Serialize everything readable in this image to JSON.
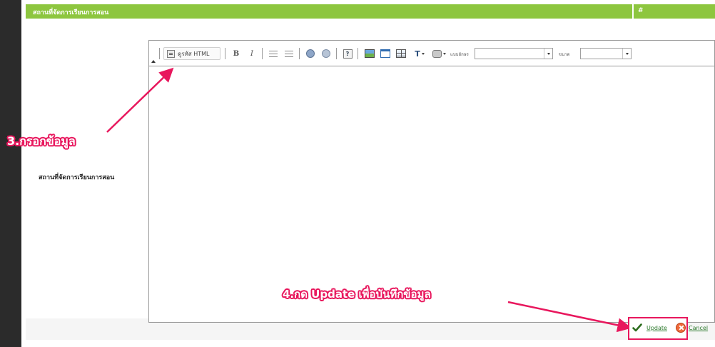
{
  "header": {
    "title": "สถานที่จัดการเรียนการสอน",
    "hash": "#"
  },
  "form": {
    "field_label": "สถานที่จัดการเรียนการสอน",
    "editor_value": ""
  },
  "toolbar": {
    "source_label": "ดูรหัส HTML",
    "bold_glyph": "B",
    "italic_glyph": "I",
    "help_glyph": "?",
    "text_color_glyph": "T",
    "font_label": "แบบอักษร",
    "font_value": "",
    "size_label": "ขนาด",
    "size_value": ""
  },
  "annotations": {
    "step3": "3.กรอกข้อมูล",
    "step4": "4.กด Update เพื่อบันทึกข้อมูล"
  },
  "actions": {
    "update_label": "Update",
    "cancel_label": "Cancel"
  },
  "colors": {
    "header_green": "#8dc63f",
    "callout_pink": "#e8175d",
    "link_green": "#2d7a2d"
  }
}
